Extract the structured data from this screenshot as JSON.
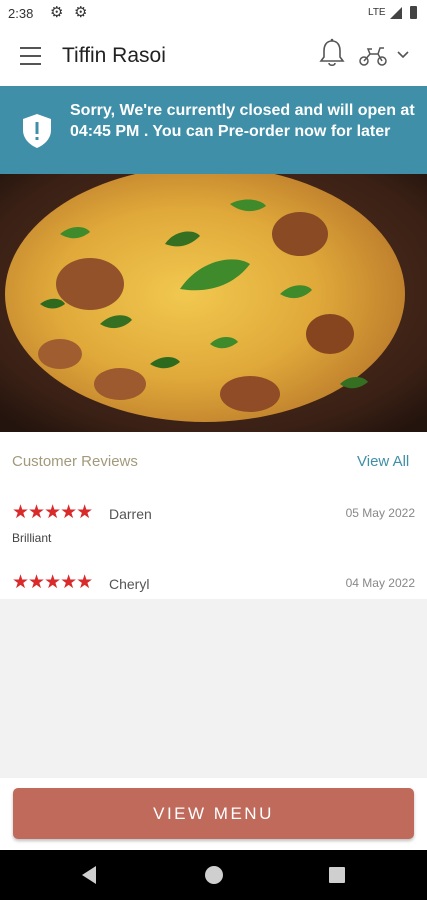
{
  "status_bar": {
    "time": "2:38",
    "network": "LTE",
    "icons": [
      "settings-icon",
      "settings-icon",
      "signal-icon",
      "battery-icon"
    ]
  },
  "app_bar": {
    "title": "Tiffin Rasoi",
    "icons": [
      "menu-icon",
      "bell-icon",
      "scooter-icon",
      "chevron-down-icon"
    ]
  },
  "banner": {
    "message": "Sorry, We're currently closed and will open at 04:45 PM . You can Pre-order now for later",
    "icon": "shield-alert-icon",
    "color": "#3f8fa8"
  },
  "hero": {
    "description_icon": "biryani-food-image"
  },
  "reviews": {
    "heading": "Customer Reviews",
    "view_all": "View All",
    "items": [
      {
        "stars": "★★★★★",
        "rating": 5,
        "name": "Darren",
        "date": "05 May 2022",
        "comment": "Brilliant"
      },
      {
        "stars": "★★★★★",
        "rating": 5,
        "name": "Cheryl",
        "date": "04 May 2022",
        "comment": ""
      }
    ]
  },
  "actions": {
    "view_menu": "VIEW MENU",
    "button_color": "#c06a5c"
  },
  "nav_bar": {
    "icons": [
      "back-icon",
      "home-icon",
      "recents-icon"
    ]
  }
}
